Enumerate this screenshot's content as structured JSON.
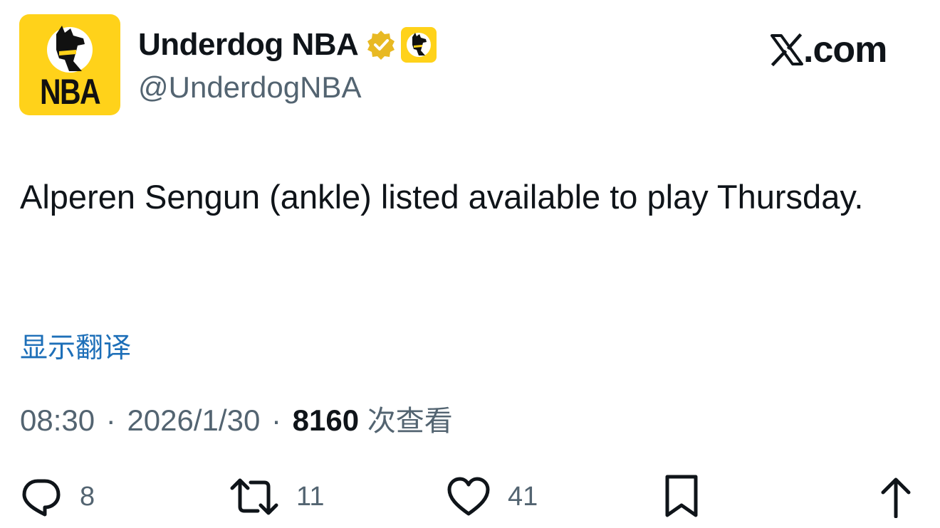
{
  "account": {
    "display_name": "Underdog NBA",
    "handle": "@UnderdogNBA",
    "avatar_text": "NBA",
    "brand_color": "#ffd21a",
    "verified_color": "#e8b923"
  },
  "branding": {
    "site_label": ".com"
  },
  "tweet": {
    "text": "Alperen Sengun (ankle) listed available to play Thursday.",
    "translate_label": "显示翻译",
    "time": "08:30",
    "separator": "·",
    "date": "2026/1/30",
    "views_count": "8160",
    "views_label": "次查看"
  },
  "actions": {
    "replies": "8",
    "retweets": "11",
    "likes": "41"
  },
  "icons": [
    "reply-icon",
    "retweet-icon",
    "like-icon",
    "bookmark-icon",
    "share-icon",
    "verified-badge-icon",
    "x-logo-icon",
    "dog-logo-icon"
  ]
}
